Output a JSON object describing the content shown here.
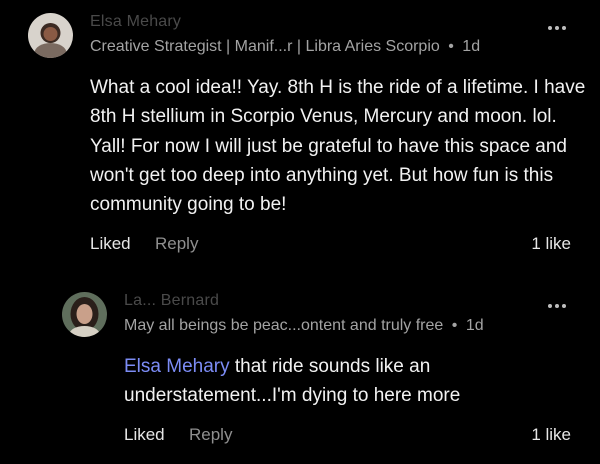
{
  "comment": {
    "author_name": "Elsa Mehary",
    "headline": "Creative Strategist | Manif...r | Libra Aries Scorpio",
    "separator": "•",
    "time": "1d",
    "body": "What a cool idea!! Yay. 8th H is the ride of a lifetime. I have 8th H stellium in Scorpio Venus, Mercury and moon. lol. Yall! For now I will just be grateful to have this space and won't get too deep into anything yet. But how fun is this community going to be!",
    "liked_label": "Liked",
    "reply_label": "Reply",
    "likes_count": "1 like"
  },
  "reply": {
    "author_name": "La...   Bernard",
    "headline": "May all beings be peac...ontent and truly free",
    "separator": "•",
    "time": "1d",
    "mention": "Elsa Mehary",
    "body": " that ride sounds like an understatement...I'm dying to here more",
    "liked_label": "Liked",
    "reply_label": "Reply",
    "likes_count": "1 like"
  },
  "colors": {
    "background": "#000000",
    "mention": "#7c8cf5",
    "secondary_text": "#a3a3a3"
  },
  "icons": [
    "more-options-icon",
    "avatar"
  ]
}
